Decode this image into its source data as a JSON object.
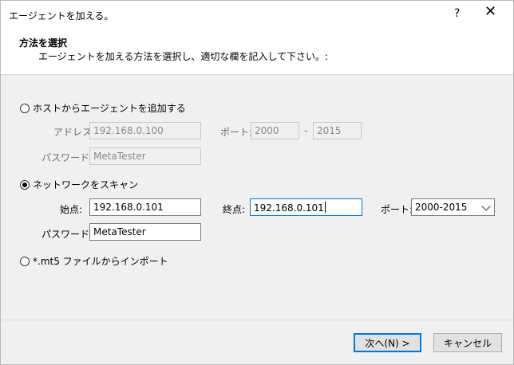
{
  "window": {
    "title": "エージェントを加える。",
    "help_glyph": "?",
    "close_glyph": "✕"
  },
  "header": {
    "title": "方法を選択",
    "subtitle": "エージェントを加える方法を選択し、適切な欄を記入して下さい。:"
  },
  "option_host": {
    "label": "ホストからエージェントを追加する",
    "selected": false,
    "address_label": "アドレス:",
    "address_value": "192.168.0.100",
    "port_label": "ポート:",
    "port_from": "2000",
    "port_dash": "-",
    "port_to": "2015",
    "password_label": "パスワード:",
    "password_value": "MetaTester"
  },
  "option_scan": {
    "label": "ネットワークをスキャン",
    "selected": true,
    "start_label": "始点:",
    "start_value": "192.168.0.101",
    "end_label": "終点:",
    "end_value": "192.168.0.101",
    "port_label": "ポート:",
    "port_value": "2000-2015",
    "password_label": "パスワード:",
    "password_value": "MetaTester"
  },
  "option_import": {
    "label": "*.mt5 ファイルからインポート",
    "selected": false
  },
  "buttons": {
    "next_label": "次へ(N) >",
    "cancel_label": "キャンセル"
  }
}
